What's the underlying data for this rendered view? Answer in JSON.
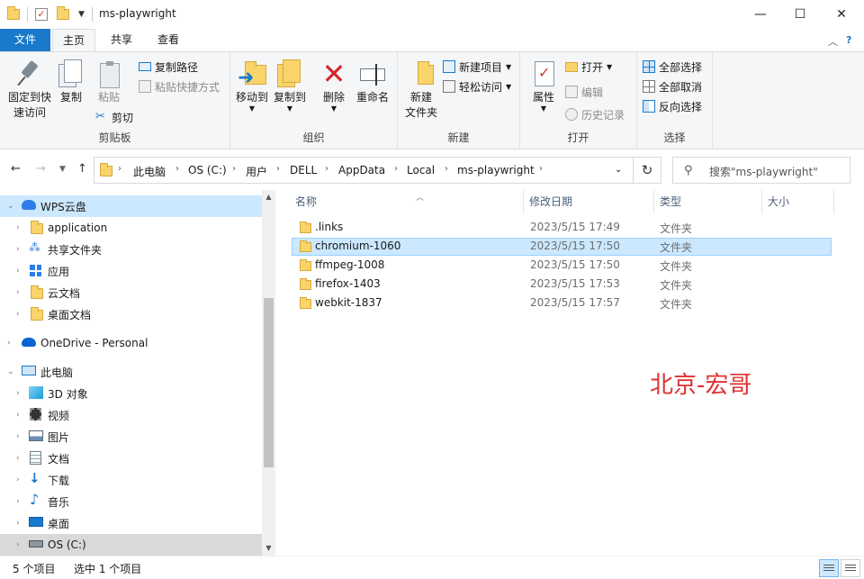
{
  "window": {
    "title": "ms-playwright",
    "minimize": "—",
    "maximize": "☐",
    "close": "✕"
  },
  "tabs": {
    "file": "文件",
    "home": "主页",
    "share": "共享",
    "view": "查看"
  },
  "ribbon": {
    "clipboard": {
      "label": "剪贴板",
      "pin": "固定到快速访问",
      "pin_line1": "固定到快",
      "pin_line2": "速访问",
      "copy": "复制",
      "paste": "粘贴",
      "copy_path": "复制路径",
      "paste_shortcut": "粘贴快捷方式",
      "cut": "剪切"
    },
    "organize": {
      "label": "组织",
      "move_to": "移动到",
      "copy_to": "复制到",
      "delete": "删除",
      "rename": "重命名"
    },
    "new": {
      "label": "新建",
      "new_folder_line1": "新建",
      "new_folder_line2": "文件夹",
      "new_item": "新建项目",
      "easy_access": "轻松访问"
    },
    "open": {
      "label": "打开",
      "properties": "属性",
      "open": "打开",
      "edit": "编辑",
      "history": "历史记录"
    },
    "select": {
      "label": "选择",
      "select_all": "全部选择",
      "select_none": "全部取消",
      "invert": "反向选择"
    }
  },
  "address": {
    "crumbs": [
      "此电脑",
      "OS (C:)",
      "用户",
      "DELL",
      "AppData",
      "Local",
      "ms-playwright"
    ],
    "search_placeholder": "搜索\"ms-playwright\""
  },
  "nav": {
    "items": [
      {
        "label": "WPS云盘"
      },
      {
        "label": "application"
      },
      {
        "label": "共享文件夹"
      },
      {
        "label": "应用"
      },
      {
        "label": "云文档"
      },
      {
        "label": "桌面文档"
      },
      {
        "label": "OneDrive - Personal"
      },
      {
        "label": "此电脑"
      },
      {
        "label": "3D 对象"
      },
      {
        "label": "视频"
      },
      {
        "label": "图片"
      },
      {
        "label": "文档"
      },
      {
        "label": "下载"
      },
      {
        "label": "音乐"
      },
      {
        "label": "桌面"
      },
      {
        "label": "OS (C:)"
      }
    ]
  },
  "columns": {
    "name": "名称",
    "date": "修改日期",
    "type": "类型",
    "size": "大小"
  },
  "files": [
    {
      "name": ".links",
      "date": "2023/5/15 17:49",
      "type": "文件夹"
    },
    {
      "name": "chromium-1060",
      "date": "2023/5/15 17:50",
      "type": "文件夹"
    },
    {
      "name": "ffmpeg-1008",
      "date": "2023/5/15 17:50",
      "type": "文件夹"
    },
    {
      "name": "firefox-1403",
      "date": "2023/5/15 17:53",
      "type": "文件夹"
    },
    {
      "name": "webkit-1837",
      "date": "2023/5/15 17:57",
      "type": "文件夹"
    }
  ],
  "watermark": "北京-宏哥",
  "status": {
    "count": "5 个项目",
    "selected": "选中 1 个项目"
  },
  "colors": {
    "accent": "#1979ca",
    "selection": "#cce8ff",
    "watermark": "#e03030"
  }
}
